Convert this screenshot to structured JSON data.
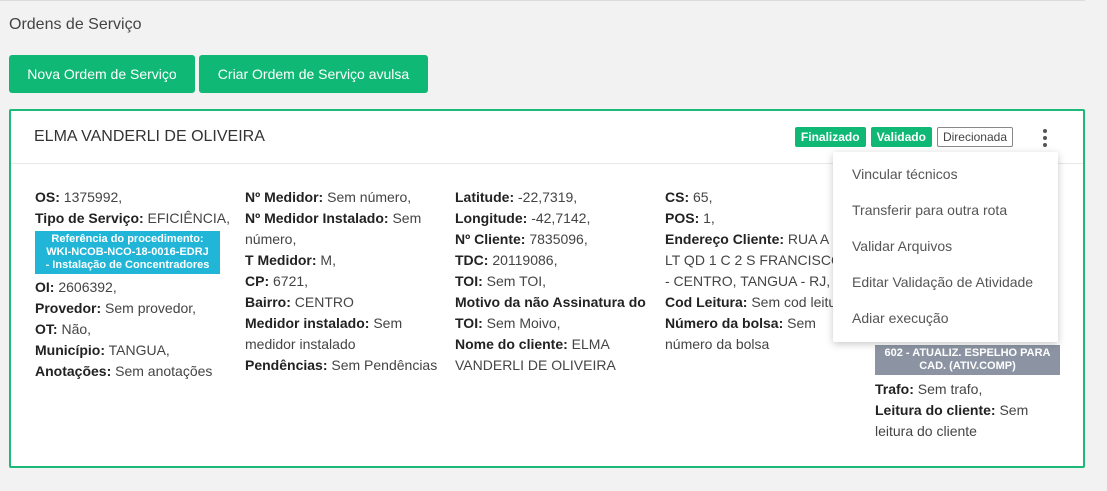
{
  "page": {
    "title": "Ordens de Serviço"
  },
  "buttons": {
    "nova": "Nova Ordem de Serviço",
    "avulsa": "Criar Ordem de Serviço avulsa"
  },
  "card": {
    "client_name": "ELMA VANDERLI DE OLIVEIRA",
    "badges": {
      "finalizado": "Finalizado",
      "validado": "Validado",
      "direcionada": "Direcionada"
    },
    "col1": {
      "os_label": "OS:",
      "os_value": " 1375992,",
      "tipo_label": "Tipo de Serviço:",
      "tipo_value": " EFICIÊNCIA,",
      "ref_badge_line1": "Referência do procedimento:",
      "ref_badge_line2": "WKI-NCOB-NCO-18-0016-EDRJ",
      "ref_badge_line3": "- Instalação de Concentradores",
      "oi_label": "OI:",
      "oi_value": " 2606392,",
      "provedor_label": "Provedor:",
      "provedor_value": " Sem provedor,",
      "ot_label": "OT:",
      "ot_value": " Não,",
      "municipio_label": "Município:",
      "municipio_value": " TANGUA,",
      "anotacoes_label": "Anotações:",
      "anotacoes_value": " Sem anotações"
    },
    "col2": {
      "medidor_label": "Nº Medidor:",
      "medidor_value": " Sem número,",
      "medidor_inst_label": "Nº Medidor Instalado:",
      "medidor_inst_value": " Sem número,",
      "t_medidor_label": "T Medidor:",
      "t_medidor_value": " M,",
      "cp_label": "CP:",
      "cp_value": " 6721,",
      "bairro_label": "Bairro:",
      "bairro_value": " CENTRO",
      "med_inst_label": "Medidor instalado:",
      "med_inst_value": " Sem medidor instalado",
      "pendencias_label": "Pendências:",
      "pendencias_value": " Sem Pendências"
    },
    "col3": {
      "lat_label": "Latitude:",
      "lat_value": " -22,7319,",
      "lon_label": "Longitude:",
      "lon_value": " -42,7142,",
      "cliente_label": "Nº Cliente:",
      "cliente_value": " 7835096,",
      "tdc_label": "TDC:",
      "tdc_value": " 20119086,",
      "toi_label": "TOI:",
      "toi_value": " Sem TOI,",
      "motivo_label": "Motivo da não Assinatura do TOI:",
      "motivo_value": " Sem Moivo,",
      "nome_label": "Nome do cliente:",
      "nome_value": " ELMA VANDERLI DE OLIVEIRA"
    },
    "col4": {
      "cs_label": "CS:",
      "cs_value": " 65,",
      "pos_label": "POS:",
      "pos_value": " 1,",
      "endereco_label": "Endereço Cliente:",
      "endereco_value": " RUA A LT QD 1 C 2 S FRANCISCO - CENTRO, TANGUA - RJ,",
      "leitura_label": "Cod Leitura:",
      "leitura_value": " Sem cod leitura",
      "bolsa_label": "Número da bolsa:",
      "bolsa_value": " Sem número da bolsa"
    },
    "col5": {
      "grey_badge_line1": "602 -  ATUALIZ. ESPELHO PARA",
      "grey_badge_line2": "CAD. (ATIV.COMP)",
      "trafo_label": "Trafo:",
      "trafo_value": " Sem trafo,",
      "leitura_cliente_label": "Leitura do cliente:",
      "leitura_cliente_value": " Sem leitura do cliente"
    }
  },
  "menu": {
    "items": [
      "Vincular técnicos",
      "Transferir para outra rota",
      "Validar Arquivos",
      "Editar Validação de Atividade",
      "Adiar execução"
    ]
  },
  "colors": {
    "accent": "#0fb874",
    "ref_badge": "#21b6d8",
    "grey_badge": "#8c94a3"
  },
  "icons": {
    "menu": "kebab-icon"
  }
}
